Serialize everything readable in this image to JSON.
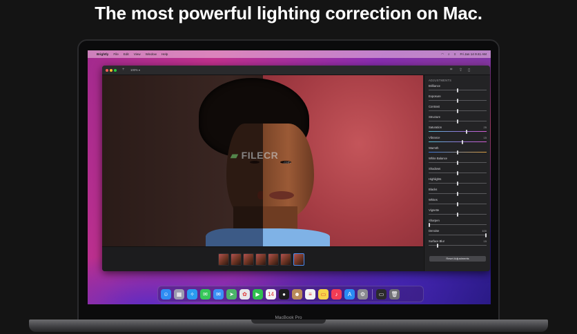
{
  "headline": "The most powerful lighting correction on Mac.",
  "device_label": "MacBook Pro",
  "menubar": {
    "app_name": "Brightly",
    "items": [
      "File",
      "Edit",
      "View",
      "Window",
      "Help"
    ],
    "clock": "Fri Jan 14  9:41 AM"
  },
  "window": {
    "zoom": "100% ▾"
  },
  "watermark": {
    "brand": "FILECR",
    "sub": ".com"
  },
  "adjustments": {
    "title": "ADJUSTMENTS",
    "sliders": [
      {
        "label": "Brilliance",
        "value": "",
        "level": 0.5
      },
      {
        "label": "Exposure",
        "value": "",
        "level": 0.5
      },
      {
        "label": "Contrast",
        "value": "",
        "level": 0.5
      },
      {
        "label": "Structure",
        "value": "",
        "level": 0.5
      },
      {
        "label": "Saturation",
        "value": "25",
        "level": 0.66
      },
      {
        "label": "Vibrance",
        "value": "15",
        "level": 0.58
      },
      {
        "label": "Warmth",
        "value": "",
        "level": 0.5
      },
      {
        "label": "White Balance",
        "value": "",
        "level": 0.5
      },
      {
        "label": "Shadows",
        "value": "",
        "level": 0.5
      },
      {
        "label": "Highlights",
        "value": "",
        "level": 0.5
      },
      {
        "label": "Blacks",
        "value": "",
        "level": 0.5
      },
      {
        "label": "Whites",
        "value": "",
        "level": 0.5
      },
      {
        "label": "Vignette",
        "value": "",
        "level": 0.5
      },
      {
        "label": "Sharpen",
        "value": "",
        "level": 0.0
      },
      {
        "label": "Denoise",
        "value": "100",
        "level": 1.0
      },
      {
        "label": "Surface Blur",
        "value": "15",
        "level": 0.15
      }
    ],
    "reset_label": "Reset Adjustments"
  },
  "filmstrip_count": 7,
  "dock_icons": [
    {
      "name": "finder-icon",
      "glyph": "☺",
      "color": "#2f8cf3"
    },
    {
      "name": "launchpad-icon",
      "glyph": "▦",
      "color": "#9a9ab0"
    },
    {
      "name": "safari-icon",
      "glyph": "✧",
      "color": "#2a9af0"
    },
    {
      "name": "messages-icon",
      "glyph": "✉",
      "color": "#35c759"
    },
    {
      "name": "mail-icon",
      "glyph": "✉",
      "color": "#3a8ff5"
    },
    {
      "name": "maps-icon",
      "glyph": "➤",
      "color": "#4cb36a"
    },
    {
      "name": "photos-icon",
      "glyph": "✿",
      "color": "#e7e7ea"
    },
    {
      "name": "facetime-icon",
      "glyph": "▶",
      "color": "#2fbf4f"
    },
    {
      "name": "calendar-icon",
      "glyph": "14",
      "color": "#f4f4f4"
    },
    {
      "name": "brightly-icon",
      "glyph": "●",
      "color": "#1c1c1e"
    },
    {
      "name": "contacts-icon",
      "glyph": "☻",
      "color": "#b98b5a"
    },
    {
      "name": "reminders-icon",
      "glyph": "≡",
      "color": "#f4f4f4"
    },
    {
      "name": "notes-icon",
      "glyph": "▭",
      "color": "#f6d54a"
    },
    {
      "name": "music-icon",
      "glyph": "♪",
      "color": "#f03c55"
    },
    {
      "name": "app-store-icon",
      "glyph": "A",
      "color": "#2a8cf3"
    },
    {
      "name": "system-preferences-icon",
      "glyph": "⚙",
      "color": "#8a8a90"
    },
    {
      "name": "screen-window-icon",
      "glyph": "▭",
      "color": "#2a2a2c"
    },
    {
      "name": "trash-icon",
      "glyph": "🗑",
      "color": "#6f6f75"
    }
  ]
}
